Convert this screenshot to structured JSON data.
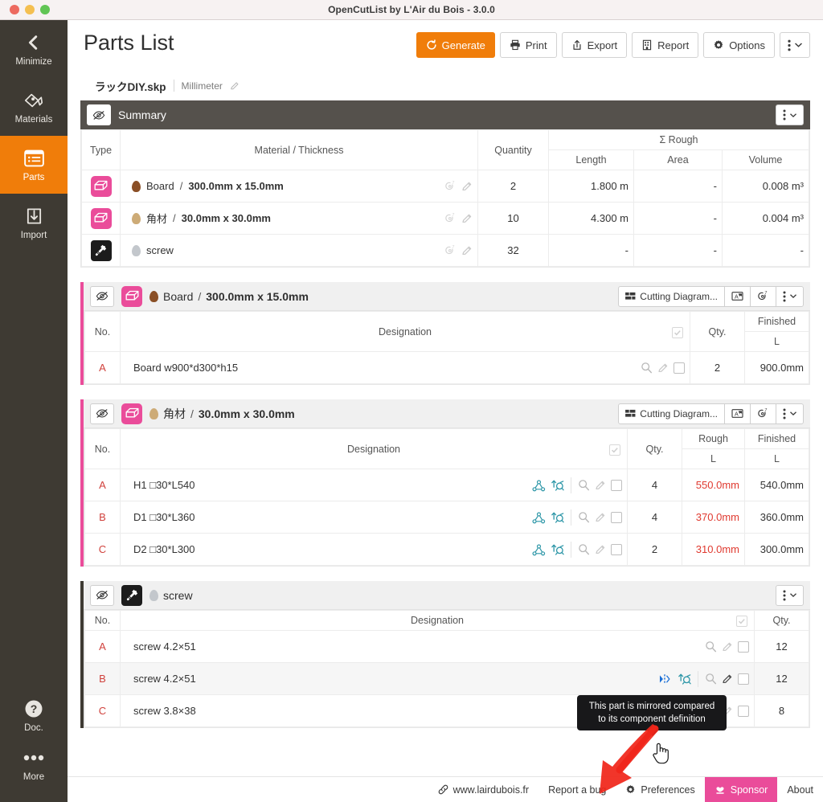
{
  "window": {
    "title": "OpenCutList by L'Air du Bois - 3.0.0",
    "controls": [
      "close",
      "minimize",
      "zoom"
    ]
  },
  "colors": {
    "accent_orange": "#f07d0a",
    "accent_pink": "#ea4c9a",
    "sidebar_dark": "#3e3a33",
    "panel_grey": "#55514c",
    "rough_red": "#e03a30",
    "letter_red": "#d0413c",
    "teal": "#2e97a8"
  },
  "sidebar": {
    "items": [
      {
        "label": "Minimize",
        "icon": "chevron-left-icon",
        "active": false
      },
      {
        "label": "Materials",
        "icon": "materials-icon",
        "active": false
      },
      {
        "label": "Parts",
        "icon": "parts-list-icon",
        "active": true
      },
      {
        "label": "Import",
        "icon": "import-icon",
        "active": false
      }
    ],
    "bottom_items": [
      {
        "label": "Doc.",
        "icon": "question-circle-icon"
      },
      {
        "label": "More",
        "icon": "ellipsis-icon"
      }
    ]
  },
  "header": {
    "title": "Parts List",
    "toolbar": [
      {
        "label": "Generate",
        "icon": "refresh-icon",
        "primary": true
      },
      {
        "label": "Print",
        "icon": "printer-icon",
        "primary": false
      },
      {
        "label": "Export",
        "icon": "export-icon",
        "primary": false
      },
      {
        "label": "Report",
        "icon": "report-icon",
        "primary": false
      },
      {
        "label": "Options",
        "icon": "gear-icon",
        "primary": false
      }
    ],
    "overflow_label": "⋮"
  },
  "tab": {
    "filename": "ラックDIY.skp",
    "unit": "Millimeter",
    "edit_icon": "pencil-icon"
  },
  "summary": {
    "title": "Summary",
    "hide_icon": "eye-slash-icon",
    "menu_icon": "kebab-icon",
    "columns": {
      "type": "Type",
      "material": "Material / Thickness",
      "quantity": "Quantity",
      "group": "Σ Rough",
      "length": "Length",
      "area": "Area",
      "volume": "Volume"
    },
    "rows": [
      {
        "type_icon": "solid-wood-icon",
        "type_bg": "#ea4c9a",
        "swatch": "#8a4f26",
        "name": "Board",
        "spec": "300.0mm x 15.0mm",
        "quantity": "2",
        "length": "1.800 m",
        "area": "-",
        "volume": "0.008 m³"
      },
      {
        "type_icon": "solid-wood-icon",
        "type_bg": "#ea4c9a",
        "swatch": "#cdab77",
        "name": "角材",
        "spec": "30.0mm x 30.0mm",
        "quantity": "10",
        "length": "4.300 m",
        "area": "-",
        "volume": "0.004 m³"
      },
      {
        "type_icon": "hardware-icon",
        "type_bg": "#1c1c1c",
        "swatch": "#c3c7cc",
        "name": "screw",
        "spec": "",
        "quantity": "32",
        "length": "-",
        "area": "-",
        "volume": "-"
      }
    ]
  },
  "groups": [
    {
      "id": "board",
      "border": "pink",
      "hide_icon": "eye-slash-icon",
      "type_icon": "solid-wood-icon",
      "type_bg": "#ea4c9a",
      "swatch": "#8a4f26",
      "name": "Board",
      "spec": "300.0mm x 15.0mm",
      "actions": [
        {
          "label": "Cutting Diagram...",
          "icon": "cutting-diagram-icon"
        },
        {
          "label": "",
          "icon": "labels-icon"
        },
        {
          "label": "",
          "icon": "layout-icon"
        },
        {
          "label": "",
          "icon": "kebab-icon"
        }
      ],
      "columns": {
        "no": "No.",
        "designation": "Designation",
        "qty": "Qty.",
        "rough": "",
        "finished": "Finished",
        "sub_rough": "",
        "sub_finished": "L"
      },
      "has_rough": false,
      "rows": [
        {
          "no": "A",
          "designation": "Board w900*d300*h15",
          "component_icons": [],
          "qty": "2",
          "rough_l": "",
          "finished_l": "900.0mm",
          "hover": false
        }
      ]
    },
    {
      "id": "kakuzai",
      "border": "pink",
      "hide_icon": "eye-slash-icon",
      "type_icon": "solid-wood-icon",
      "type_bg": "#ea4c9a",
      "swatch": "#cdab77",
      "name": "角材",
      "spec": "30.0mm x 30.0mm",
      "actions": [
        {
          "label": "Cutting Diagram...",
          "icon": "cutting-diagram-icon"
        },
        {
          "label": "",
          "icon": "labels-icon"
        },
        {
          "label": "",
          "icon": "layout-icon"
        },
        {
          "label": "",
          "icon": "kebab-icon"
        }
      ],
      "columns": {
        "no": "No.",
        "designation": "Designation",
        "qty": "Qty.",
        "rough": "Rough",
        "finished": "Finished",
        "sub_rough": "L",
        "sub_finished": "L"
      },
      "has_rough": true,
      "rows": [
        {
          "no": "A",
          "designation": "H1 □30*L540",
          "component_icons": [
            "axis-icon",
            "flip-icon"
          ],
          "qty": "4",
          "rough_l": "550.0mm",
          "finished_l": "540.0mm",
          "hover": false
        },
        {
          "no": "B",
          "designation": "D1 □30*L360",
          "component_icons": [
            "axis-icon",
            "flip-icon"
          ],
          "qty": "4",
          "rough_l": "370.0mm",
          "finished_l": "360.0mm",
          "hover": false
        },
        {
          "no": "C",
          "designation": "D2 □30*L300",
          "component_icons": [
            "axis-icon",
            "flip-icon"
          ],
          "qty": "2",
          "rough_l": "310.0mm",
          "finished_l": "300.0mm",
          "hover": false
        }
      ]
    },
    {
      "id": "screw",
      "border": "dark",
      "hide_icon": "eye-slash-icon",
      "type_icon": "hardware-icon",
      "type_bg": "#1c1c1c",
      "swatch": "#c3c7cc",
      "name": "screw",
      "spec": "",
      "actions": [
        {
          "label": "",
          "icon": "kebab-icon"
        }
      ],
      "columns": {
        "no": "No.",
        "designation": "Designation",
        "qty": "Qty.",
        "rough": "",
        "finished": "",
        "sub_rough": "",
        "sub_finished": ""
      },
      "has_rough": false,
      "simple": true,
      "rows": [
        {
          "no": "A",
          "designation": "screw 4.2×51",
          "component_icons": [],
          "qty": "12",
          "rough_l": "",
          "finished_l": "",
          "hover": false
        },
        {
          "no": "B",
          "designation": "screw 4.2×51",
          "component_icons": [
            "mirror-icon",
            "flip-icon"
          ],
          "qty": "12",
          "rough_l": "",
          "finished_l": "",
          "hover": true
        },
        {
          "no": "C",
          "designation": "screw 3.8×38",
          "component_icons": [
            "flip-icon"
          ],
          "qty": "8",
          "rough_l": "",
          "finished_l": "",
          "hover": false
        }
      ]
    }
  ],
  "tooltip": {
    "text": "This part is mirrored compared to its component definition"
  },
  "footer": {
    "items": [
      {
        "label": "www.lairdubois.fr",
        "icon": "link-icon",
        "style": "plain"
      },
      {
        "label": "Report a bug",
        "icon": "",
        "style": "plain"
      },
      {
        "label": "Preferences",
        "icon": "gear-icon",
        "style": "plain"
      },
      {
        "label": "Sponsor",
        "icon": "heart-hand-icon",
        "style": "sponsor"
      },
      {
        "label": "About",
        "icon": "",
        "style": "plain"
      }
    ]
  }
}
